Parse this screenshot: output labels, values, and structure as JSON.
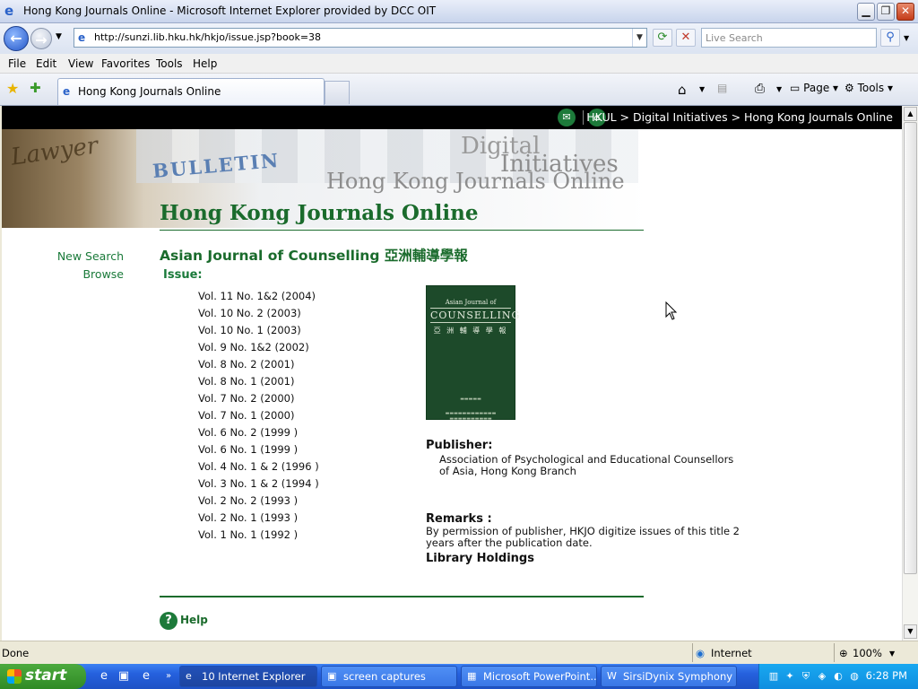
{
  "window": {
    "title": "Hong Kong Journals Online - Microsoft Internet Explorer provided by DCC OIT"
  },
  "toolbar": {
    "url": "http://sunzi.lib.hku.hk/hkjo/issue.jsp?book=38",
    "search_placeholder": "Live Search"
  },
  "menu": [
    "File",
    "Edit",
    "View",
    "Favorites",
    "Tools",
    "Help"
  ],
  "tabs": {
    "active_label": "Hong Kong Journals Online",
    "commands": {
      "page": "Page",
      "tools": "Tools"
    }
  },
  "page": {
    "breadcrumb": "HKUL > Digital Initiatives > Hong Kong Journals Online",
    "banner": {
      "line1": "Digital",
      "line2": "Initiatives",
      "line3": "Hong Kong Journals Online",
      "bulletin": "BULLETIN",
      "lawyer": "Lawyer"
    },
    "site_title": "Hong Kong Journals Online",
    "sidenav": [
      "New Search",
      "Browse"
    ],
    "journal_title": "Asian Journal of Counselling 亞洲輔導學報",
    "issue_label": "Issue:",
    "issues": [
      "Vol. 11 No. 1&2 (2004)",
      "Vol. 10 No. 2 (2003)",
      "Vol. 10 No. 1 (2003)",
      "Vol. 9 No. 1&2 (2002)",
      "Vol. 8 No. 2 (2001)",
      "Vol. 8 No. 1 (2001)",
      "Vol. 7 No. 2 (2000)",
      "Vol. 7 No. 1 (2000)",
      "Vol. 6 No. 2 (1999 )",
      "Vol. 6 No. 1 (1999 )",
      "Vol. 4 No. 1 & 2 (1996 )",
      "Vol. 3 No. 1 & 2 (1994 )",
      "Vol. 2 No. 2 (1993 )",
      "Vol. 2 No. 1 (1993 )",
      "Vol. 1 No. 1 (1992 )"
    ],
    "cover": {
      "top": "Asian Journal of",
      "main": "COUNSELLING",
      "chinese": "亞 洲 輔 導 學 報"
    },
    "publisher_label": "Publisher:",
    "publisher_text": "Association of Psychological and Educational Counsellors of Asia, Hong Kong Branch",
    "remarks_label": "Remarks :",
    "remarks_text": "By permission of publisher, HKJO digitize issues of this title 2 years after the publication date.",
    "holdings_label": "Library Holdings",
    "help_label": "Help"
  },
  "status": {
    "text": "Done",
    "zone": "Internet",
    "zoom": "100%"
  },
  "taskbar": {
    "start": "start",
    "tasks": [
      {
        "label": "10 Internet Explorer"
      },
      {
        "label": "screen captures"
      },
      {
        "label": "Microsoft PowerPoint..."
      },
      {
        "label": "SirsiDynix Symphony ..."
      }
    ],
    "clock": "6:28 PM"
  },
  "colors": {
    "brand_green": "#1a6b2c",
    "link_green": "#1a7a3a",
    "cover_green": "#1d4a2a",
    "taskbar_blue": "#2560dd"
  }
}
